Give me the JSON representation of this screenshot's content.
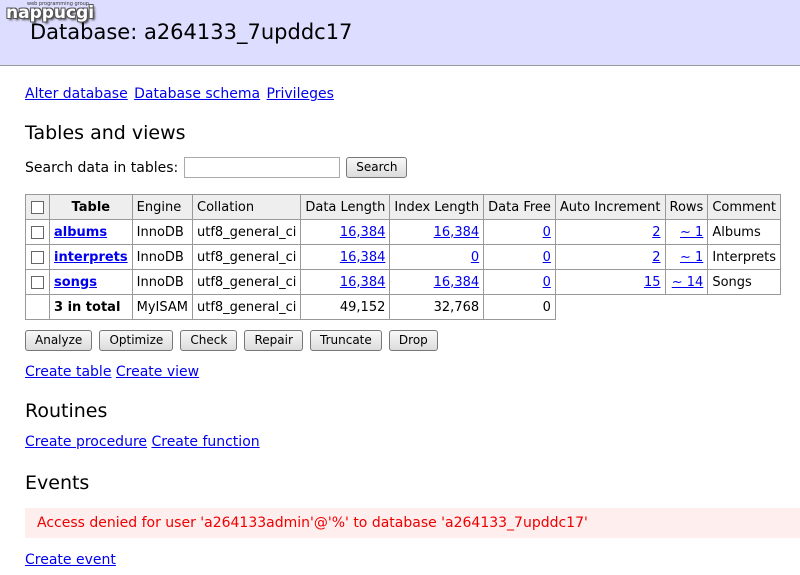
{
  "header": {
    "logo": "nappucgi",
    "logo_sub": "web programming group",
    "title": "Database: a264133_7upddc17"
  },
  "db_links": [
    "Alter database",
    "Database schema",
    "Privileges"
  ],
  "tables_section": {
    "heading": "Tables and views",
    "search_label": "Search data in tables:",
    "search_value": "",
    "search_button": "Search",
    "columns": [
      "Table",
      "Engine",
      "Collation",
      "Data Length",
      "Index Length",
      "Data Free",
      "Auto Increment",
      "Rows",
      "Comment"
    ],
    "rows": [
      {
        "table": "albums",
        "engine": "InnoDB",
        "collation": "utf8_general_ci",
        "data_length": "16,384",
        "index_length": "16,384",
        "data_free": "0",
        "auto_increment": "2",
        "rows": "~ 1",
        "comment": "Albums"
      },
      {
        "table": "interprets",
        "engine": "InnoDB",
        "collation": "utf8_general_ci",
        "data_length": "16,384",
        "index_length": "0",
        "data_free": "0",
        "auto_increment": "2",
        "rows": "~ 1",
        "comment": "Interprets"
      },
      {
        "table": "songs",
        "engine": "InnoDB",
        "collation": "utf8_general_ci",
        "data_length": "16,384",
        "index_length": "16,384",
        "data_free": "0",
        "auto_increment": "15",
        "rows": "~ 14",
        "comment": "Songs"
      }
    ],
    "total": {
      "table": "3 in total",
      "engine": "MyISAM",
      "collation": "utf8_general_ci",
      "data_length": "49,152",
      "index_length": "32,768",
      "data_free": "0"
    },
    "actions": [
      "Analyze",
      "Optimize",
      "Check",
      "Repair",
      "Truncate",
      "Drop"
    ],
    "create_links": [
      "Create table",
      "Create view"
    ]
  },
  "routines_section": {
    "heading": "Routines",
    "create_links": [
      "Create procedure",
      "Create function"
    ]
  },
  "events_section": {
    "heading": "Events",
    "error": "Access denied for user 'a264133admin'@'%' to database 'a264133_7upddc17'",
    "create_link": "Create event"
  }
}
